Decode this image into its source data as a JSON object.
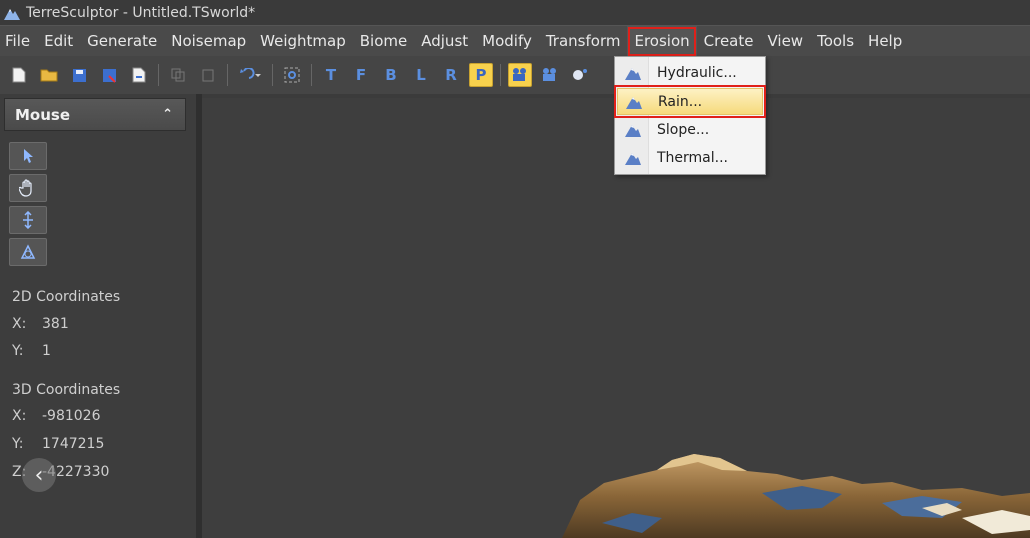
{
  "window": {
    "title": "TerreSculptor - Untitled.TSworld*"
  },
  "menubar": {
    "items": [
      {
        "label": "File"
      },
      {
        "label": "Edit"
      },
      {
        "label": "Generate"
      },
      {
        "label": "Noisemap"
      },
      {
        "label": "Weightmap"
      },
      {
        "label": "Biome"
      },
      {
        "label": "Adjust"
      },
      {
        "label": "Modify"
      },
      {
        "label": "Transform"
      },
      {
        "label": "Erosion"
      },
      {
        "label": "Create"
      },
      {
        "label": "View"
      },
      {
        "label": "Tools"
      },
      {
        "label": "Help"
      }
    ],
    "active": "Erosion"
  },
  "toolbar": {
    "letters": [
      "T",
      "F",
      "B",
      "L",
      "R",
      "P"
    ],
    "selected": "P"
  },
  "erosion_menu": {
    "items": [
      {
        "label": "Hydraulic..."
      },
      {
        "label": "Rain..."
      },
      {
        "label": "Slope..."
      },
      {
        "label": "Thermal..."
      }
    ],
    "highlighted": "Rain..."
  },
  "left_panel": {
    "title": "Mouse",
    "coords_2d": {
      "heading": "2D Coordinates",
      "x_label": "X:",
      "x": "381",
      "y_label": "Y:",
      "y": "1"
    },
    "coords_3d": {
      "heading": "3D Coordinates",
      "x_label": "X:",
      "x": "-981026",
      "y_label": "Y:",
      "y": "1747215",
      "z_label": "Z:",
      "z": "-4227330"
    }
  },
  "colors": {
    "menu_highlight": "#e0201a",
    "selection_yellow": "#f7d14d",
    "dark_bg": "#3b3b3b"
  }
}
